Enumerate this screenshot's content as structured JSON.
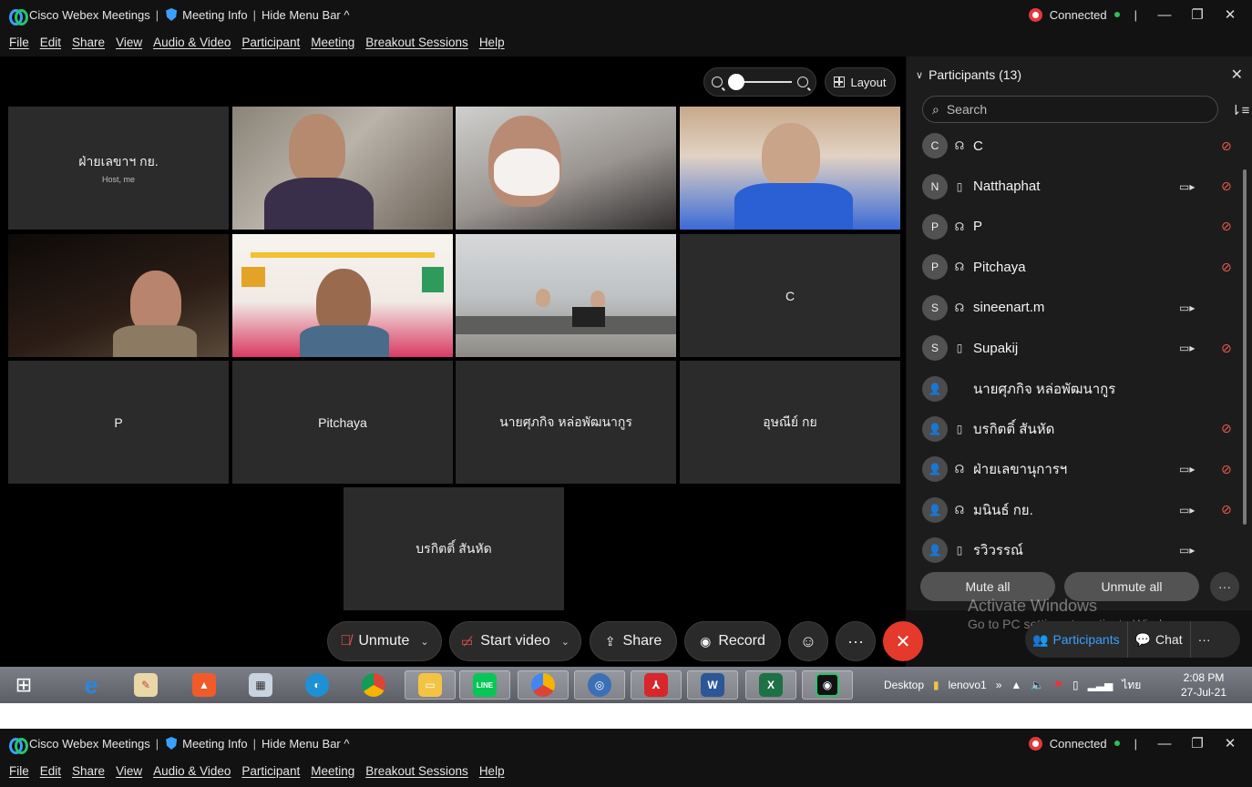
{
  "titlebar": {
    "app_title": "Cisco Webex Meetings",
    "meeting_info": "Meeting Info",
    "hide_menu": "Hide Menu Bar ^",
    "status": "Connected"
  },
  "menu": [
    "File",
    "Edit",
    "Share",
    "View",
    "Audio & Video",
    "Participant",
    "Meeting",
    "Breakout Sessions",
    "Help"
  ],
  "stage": {
    "layout_label": "Layout",
    "zoom_level": 0,
    "tiles": {
      "host": "ฝ่ายเลขาฯ กย.",
      "host_sub": "Host, me",
      "c": "C",
      "p": "P",
      "pitchaya": "Pitchaya",
      "sukij": "นายศุภกิจ หล่อพัฒนากูร",
      "usanee": "อุษณีย์ กย",
      "borkit": "บรกิตติ์ สันหัด"
    }
  },
  "controls": {
    "unmute": "Unmute",
    "start_video": "Start video",
    "share": "Share",
    "record": "Record"
  },
  "panel": {
    "title": "Participants (13)",
    "search_placeholder": "Search",
    "participants": [
      {
        "initial": "C",
        "name": "C",
        "device": "headset",
        "camera": false,
        "muted": true
      },
      {
        "initial": "N",
        "name": "Natthaphat",
        "device": "phone",
        "camera": true,
        "muted": true
      },
      {
        "initial": "P",
        "name": "P",
        "device": "headset",
        "camera": false,
        "muted": true
      },
      {
        "initial": "P",
        "name": "Pitchaya",
        "device": "headset",
        "camera": false,
        "muted": true
      },
      {
        "initial": "S",
        "name": "sineenart.m",
        "device": "headset",
        "camera": true,
        "muted": false
      },
      {
        "initial": "S",
        "name": "Supakij",
        "device": "phone",
        "camera": true,
        "muted": true
      },
      {
        "initial": "",
        "name": "นายศุภกิจ หล่อพัฒนากูร",
        "device": "",
        "camera": false,
        "muted": false
      },
      {
        "initial": "",
        "name": "บรกิตติ์ สันหัด",
        "device": "phone",
        "camera": false,
        "muted": true
      },
      {
        "initial": "",
        "name": "ฝ่ายเลขานุการฯ",
        "device": "headset",
        "camera": true,
        "muted": true
      },
      {
        "initial": "",
        "name": "มนินธ์ กย.",
        "device": "headset",
        "camera": true,
        "muted": true
      },
      {
        "initial": "",
        "name": "รวิวรรณ์",
        "device": "phone",
        "camera": true,
        "muted": false
      }
    ],
    "mute_all": "Mute all",
    "unmute_all": "Unmute all"
  },
  "bottom_tabs": {
    "participants": "Participants",
    "chat": "Chat"
  },
  "watermark": {
    "line1": "Activate Windows",
    "line2": "Go to PC settings to activate Windows."
  },
  "taskbar": {
    "desktop": "Desktop",
    "user": "lenovo1",
    "lang": "ไทย",
    "time": "2:08 PM",
    "date": "27-Jul-21"
  },
  "colors": {
    "accent": "#3aa0ff",
    "end_call": "#e5392c",
    "muted_icon": "#ef5a4a",
    "connected_dot": "#2fbf59"
  }
}
